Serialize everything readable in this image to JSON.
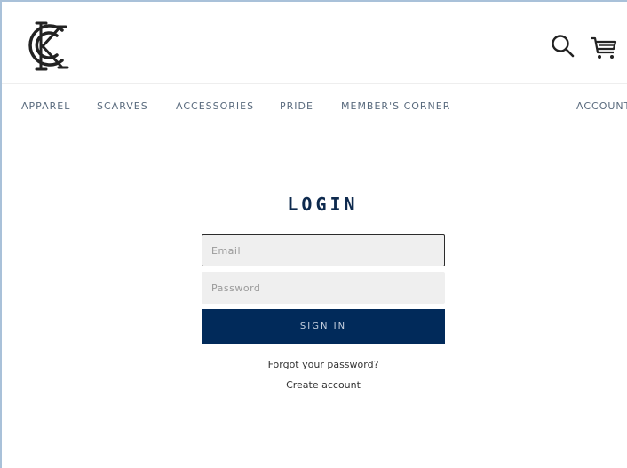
{
  "header": {
    "logo_icon": "kc-monogram-logo",
    "search_icon": "search-icon",
    "cart_icon": "cart-icon"
  },
  "nav": {
    "items": [
      {
        "label": "APPAREL"
      },
      {
        "label": "SCARVES"
      },
      {
        "label": "ACCESSORIES"
      },
      {
        "label": "PRIDE"
      },
      {
        "label": "MEMBER'S CORNER"
      }
    ],
    "account": "ACCOUNT"
  },
  "login": {
    "title": "LOGIN",
    "email_placeholder": "Email",
    "password_placeholder": "Password",
    "submit_label": "SIGN IN",
    "forgot_link": "Forgot your password?",
    "create_link": "Create account"
  },
  "colors": {
    "brand_navy": "#012a5a",
    "nav_text": "#5a6b7e",
    "field_bg": "#efefef"
  }
}
